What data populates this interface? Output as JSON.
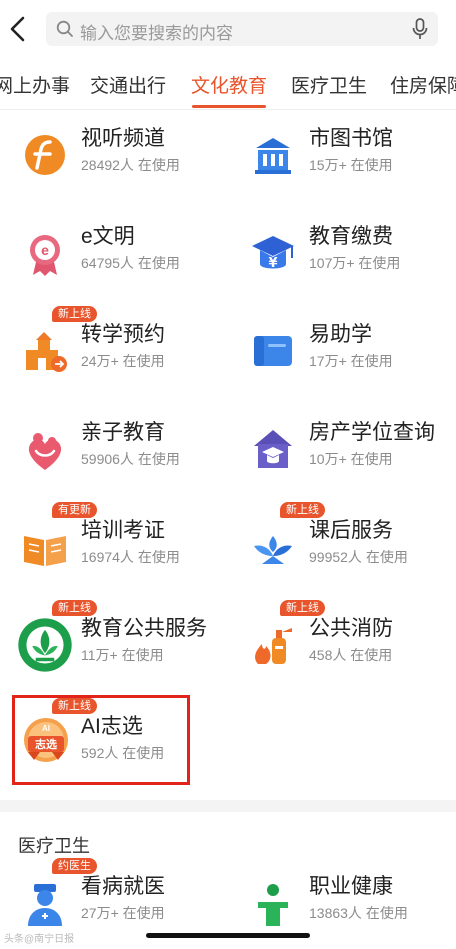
{
  "search": {
    "placeholder": "输入您要搜索的内容"
  },
  "tabs": [
    {
      "label": "网上办事"
    },
    {
      "label": "交通出行"
    },
    {
      "label": "文化教育"
    },
    {
      "label": "医疗卫生"
    },
    {
      "label": "住房保障"
    }
  ],
  "services": [
    {
      "title": "视听频道",
      "sub": "28492人 在使用",
      "icon": "f-logo-icon"
    },
    {
      "title": "市图书馆",
      "sub": "15万+ 在使用",
      "icon": "library-icon"
    },
    {
      "title": "e文明",
      "sub": "64795人 在使用",
      "icon": "e-medal-icon"
    },
    {
      "title": "教育缴费",
      "sub": "107万+ 在使用",
      "icon": "grad-cap-yuan-icon"
    },
    {
      "title": "转学预约",
      "sub": "24万+ 在使用",
      "icon": "school-transfer-icon",
      "badge": "新上线"
    },
    {
      "title": "易助学",
      "sub": "17万+ 在使用",
      "icon": "wallet-book-icon"
    },
    {
      "title": "亲子教育",
      "sub": "59906人 在使用",
      "icon": "parent-child-icon"
    },
    {
      "title": "房产学位查询",
      "sub": "10万+ 在使用",
      "icon": "house-cap-icon"
    },
    {
      "title": "培训考证",
      "sub": "16974人 在使用",
      "icon": "open-book-icon",
      "badge": "有更新"
    },
    {
      "title": "课后服务",
      "sub": "99952人 在使用",
      "icon": "sprout-icon",
      "badge": "新上线"
    },
    {
      "title": "教育公共服务",
      "sub": "11万+ 在使用",
      "icon": "education-seal-icon",
      "badge": "新上线"
    },
    {
      "title": "公共消防",
      "sub": "458人 在使用",
      "icon": "fire-extinguisher-icon",
      "badge": "新上线"
    },
    {
      "title": "AI志选",
      "sub": "592人 在使用",
      "icon": "ai-zhixuan-icon",
      "badge": "新上线",
      "icon_text": "志选",
      "icon_small": "AI"
    }
  ],
  "section2": {
    "title": "医疗卫生",
    "items": [
      {
        "title": "看病就医",
        "sub": "27万+ 在使用",
        "icon": "doctor-icon",
        "badge": "约医生"
      },
      {
        "title": "职业健康",
        "sub": "13863人 在使用",
        "icon": "worker-health-icon"
      }
    ]
  },
  "watermark": "头条@南宁日报",
  "colors": {
    "accent": "#e8542b",
    "highlight": "#e2231a"
  }
}
